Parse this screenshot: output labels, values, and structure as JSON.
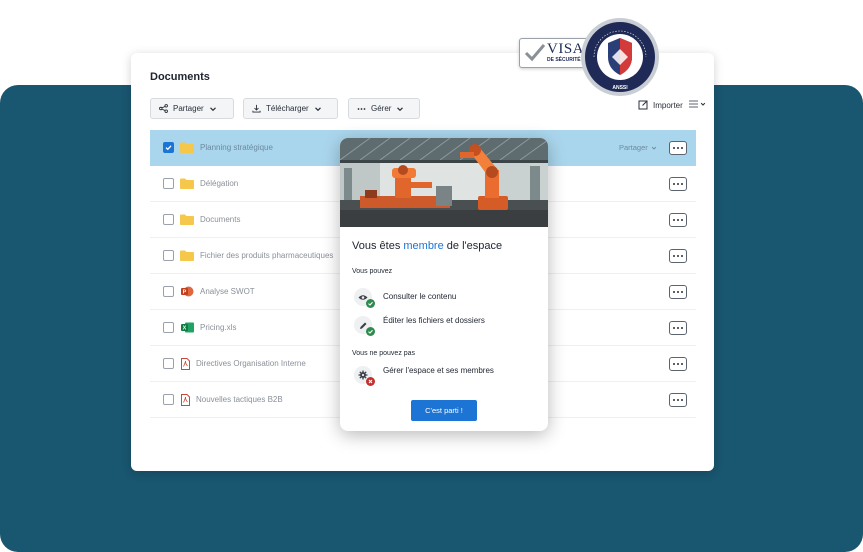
{
  "card": {
    "title": "Documents",
    "toolbar": {
      "share_label": "Partager",
      "download_label": "Télécharger",
      "manage_label": "Gérer",
      "import_label": "Importer"
    },
    "rows": [
      {
        "name": "Planning stratégique",
        "type": "folder",
        "selected": true,
        "share_label": "Partager"
      },
      {
        "name": "Délégation",
        "type": "folder"
      },
      {
        "name": "Documents",
        "type": "folder"
      },
      {
        "name": "Fichier des produits pharmaceutiques",
        "type": "folder"
      },
      {
        "name": "Analyse SWOT",
        "type": "powerpoint"
      },
      {
        "name": "Pricing.xls",
        "type": "excel"
      },
      {
        "name": "Directives Organisation Interne",
        "type": "pdf"
      },
      {
        "name": "Nouvelles tactiques B2B",
        "type": "pdf"
      }
    ]
  },
  "popup": {
    "heading_prefix": "Vous êtes ",
    "heading_highlight": "membre",
    "heading_suffix": " de l'espace",
    "can_title": "Vous pouvez",
    "can": [
      {
        "label": "Consulter le contenu",
        "icon": "eye-icon"
      },
      {
        "label": "Éditer les fichiers et dossiers",
        "icon": "pencil-icon"
      }
    ],
    "cannot_title": "Vous ne pouvez pas",
    "cannot": [
      {
        "label": "Gérer l'espace et ses membres",
        "icon": "gear-icon"
      }
    ],
    "cta_label": "C'est parti !"
  },
  "badge": {
    "visa_text": "VISA",
    "visa_sub": "DE SÉCURITÉ",
    "seal_text": "ANSSI"
  },
  "colors": {
    "background_panel": "#19566f",
    "accent": "#1c74d4",
    "selected_row": "#aad6ed",
    "success": "#2e8b4e",
    "danger": "#c62f2f"
  }
}
